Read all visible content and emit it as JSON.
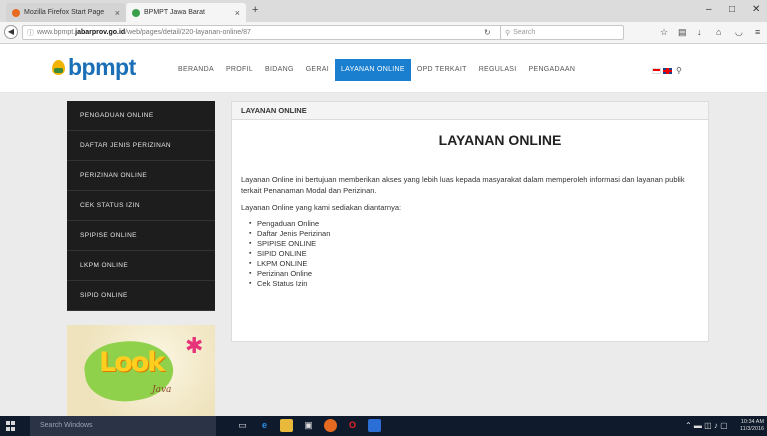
{
  "browser": {
    "tabs": [
      {
        "title": "Mozilla Firefox Start Page",
        "active": false
      },
      {
        "title": "BPMPT Jawa Barat",
        "active": true
      }
    ],
    "new_tab": "+",
    "close_glyph": "×",
    "url_prefix": "www.bpmpt.",
    "url_domain": "jabarprov.go.id",
    "url_path": "/web/pages/detail/220-layanan-online/87",
    "search_placeholder": "Search",
    "window_controls": [
      "–",
      "□",
      "✕"
    ]
  },
  "site": {
    "logo_text": "bpmpt",
    "menu": [
      "BERANDA",
      "PROFIL",
      "BIDANG",
      "GERAI",
      "LAYANAN ONLINE",
      "OPD TERKAIT",
      "REGULASI",
      "PENGADAAN"
    ],
    "active_menu": "LAYANAN ONLINE"
  },
  "sidebar": {
    "items": [
      "PENGADUAN ONLINE",
      "DAFTAR JENIS PERIZINAN",
      "PERIZINAN ONLINE",
      "CEK STATUS IZIN",
      "SPIPISE ONLINE",
      "LKPM ONLINE",
      "SIPID ONLINE"
    ],
    "banner_word": "Look",
    "banner_sub": "Java"
  },
  "panel": {
    "header": "LAYANAN ONLINE",
    "title": "LAYANAN ONLINE",
    "intro": "Layanan Online ini bertujuan memberikan akses yang lebih luas kepada masyarakat dalam memperoleh informasi dan layanan publik terkait Penanaman Modal dan Perizinan.",
    "list_intro": "Layanan Online yang kami sediakan diantarnya:",
    "services": [
      "Pengaduan Online",
      "Daftar Jenis Perizinan",
      "SPIPISE ONLINE",
      "SIPID ONLINE",
      "LKPM ONLINE",
      "Perizinan Online",
      "Cek Status Izin"
    ]
  },
  "taskbar": {
    "search_placeholder": "Search Windows",
    "time": "10:34 AM",
    "date": "11/3/2016"
  },
  "colors": {
    "brand_blue": "#1b6fb6",
    "active_menu": "#1b7fd0",
    "sidebar_bg": "#1d1d1d",
    "taskbar_bg": "#0f1b2d"
  }
}
